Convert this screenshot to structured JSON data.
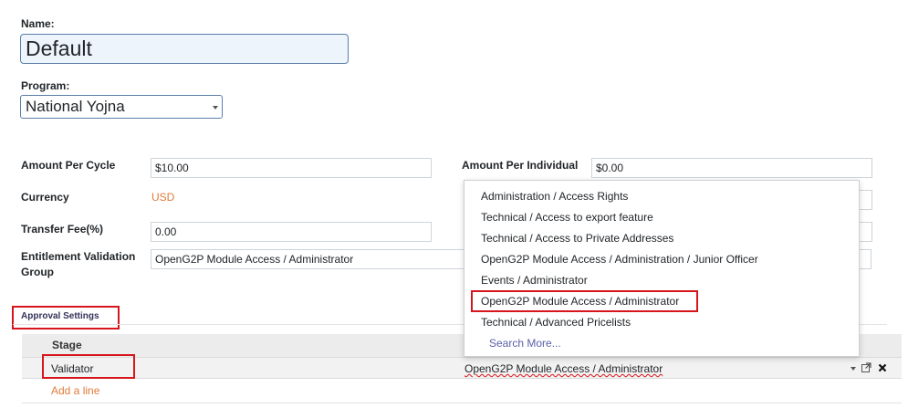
{
  "form": {
    "name_label": "Name:",
    "name_value": "Default",
    "program_label": "Program:",
    "program_value": "National Yojna",
    "amount_per_cycle_label": "Amount Per Cycle",
    "amount_per_cycle_value": "$10.00",
    "currency_label": "Currency",
    "currency_value": "USD",
    "transfer_fee_label": "Transfer Fee(%)",
    "transfer_fee_value": "0.00",
    "entitlement_validation_group_label_line1": "Entitlement Validation",
    "entitlement_validation_group_label_line2": "Group",
    "entitlement_validation_group_value": "OpenG2P Module Access / Administrator",
    "amount_per_individual_label": "Amount Per Individual",
    "amount_per_individual_value": "$0.00"
  },
  "dropdown": {
    "items": [
      "Administration / Access Rights",
      "Technical / Access to export feature",
      "Technical / Access to Private Addresses",
      "OpenG2P Module Access / Administration / Junior Officer",
      "Events / Administrator",
      "OpenG2P Module Access / Administrator",
      "Technical / Advanced Pricelists"
    ],
    "search_more": "Search More..."
  },
  "approval": {
    "section_title": "Approval Settings",
    "col_stage": "Stage",
    "row_stage": "Validator",
    "row_group": "OpenG2P Module Access / Administrator",
    "add_line": "Add a line"
  },
  "colors": {
    "highlight": "#d6161c",
    "link": "#e07b3a",
    "search_more": "#5b5fa8"
  }
}
